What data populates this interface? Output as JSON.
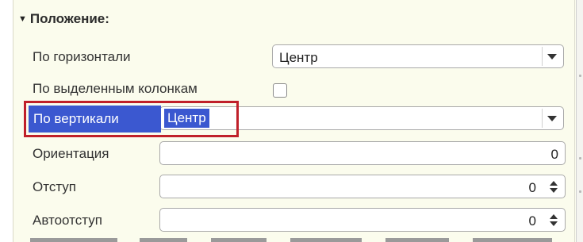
{
  "group": {
    "title": "Положение:",
    "expanded_icon": "triangle-down-icon"
  },
  "rows": {
    "horizontal": {
      "label": "По горизонтали",
      "value": "Центр"
    },
    "selected_columns": {
      "label": "По выделенным колонкам",
      "checked": false
    },
    "vertical": {
      "label": "По вертикали",
      "value": "Центр"
    },
    "orientation": {
      "label": "Ориентация",
      "value": "0"
    },
    "indent": {
      "label": "Отступ",
      "value": "0"
    },
    "auto_indent": {
      "label": "Автоотступ",
      "value": "0"
    }
  },
  "colors": {
    "panel_bg": "#fbfced",
    "selection": "#3b58d0",
    "highlight_border": "#c0202a"
  }
}
